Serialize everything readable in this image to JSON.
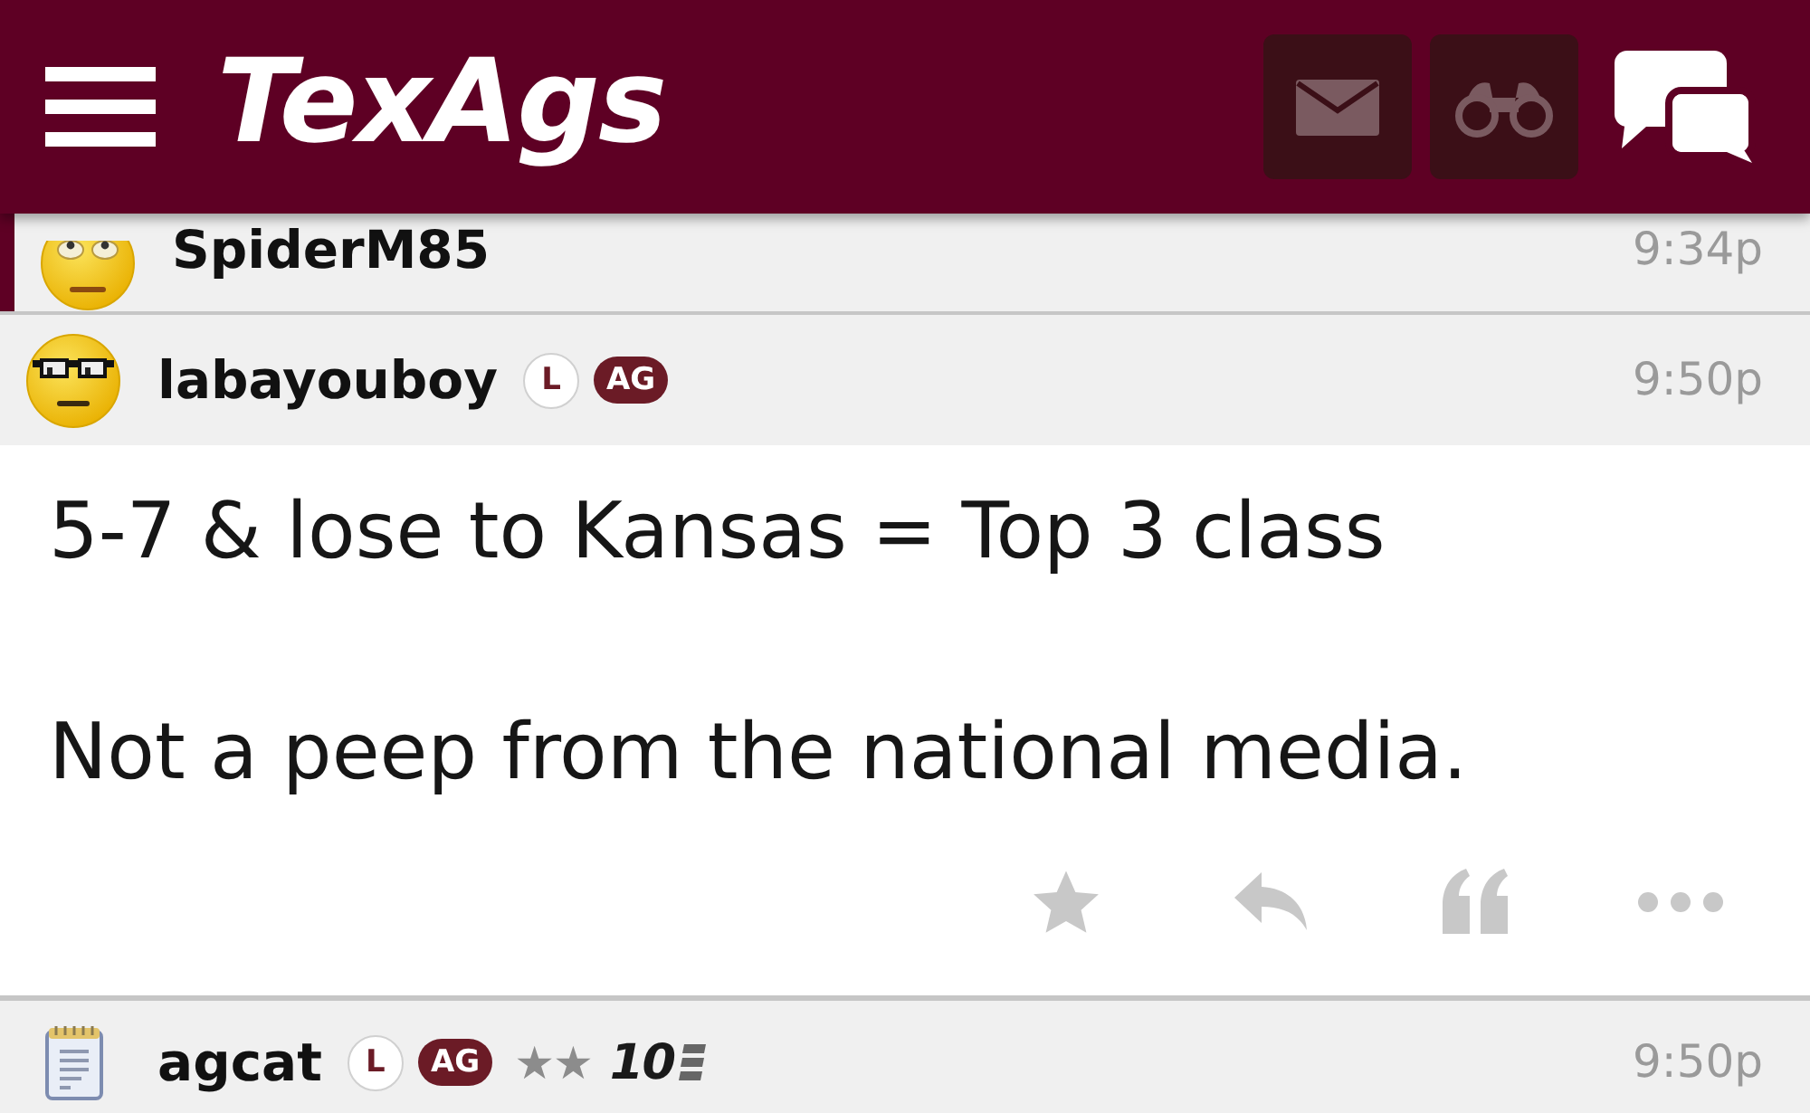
{
  "header": {
    "logo": "TexAgs"
  },
  "posts": [
    {
      "author": "SpiderM85",
      "time": "9:34p",
      "highlighted": true
    },
    {
      "author": "labayouboy",
      "badges": [
        {
          "text": "L",
          "kind": "outline"
        },
        {
          "text": "AG",
          "kind": "filled"
        }
      ],
      "time": "9:50p",
      "highlighted": false,
      "body": [
        "5-7 & lose to Kansas = Top 3 class",
        "Not a peep from the national media."
      ]
    },
    {
      "author": "agcat",
      "badges": [
        {
          "text": "L",
          "kind": "outline"
        },
        {
          "text": "AG",
          "kind": "filled"
        }
      ],
      "rank_stars": "★★",
      "rank": "10",
      "time": "9:50p",
      "highlighted": false
    }
  ]
}
